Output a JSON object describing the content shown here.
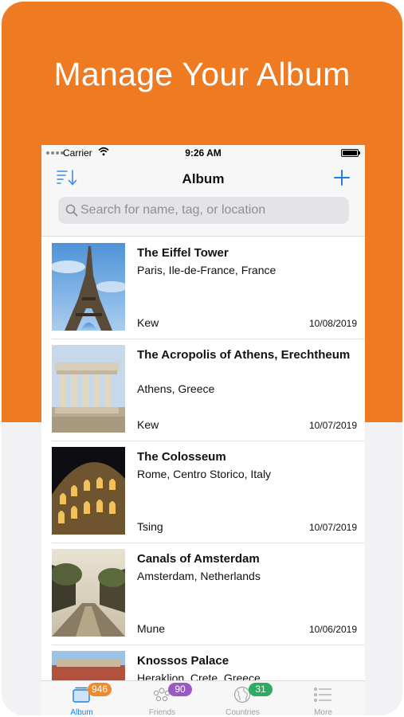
{
  "headline": "Manage Your Album",
  "status": {
    "carrier": "Carrier",
    "time": "9:26 AM"
  },
  "nav": {
    "title": "Album",
    "sort_icon": "sort-icon",
    "add_icon": "plus-icon"
  },
  "search": {
    "placeholder": "Search for name, tag, or location",
    "value": ""
  },
  "items": [
    {
      "name": "The Eiffel Tower",
      "location": "Paris, Ile-de-France, France",
      "user": "Kew",
      "date": "10/08/2019"
    },
    {
      "name": "The Acropolis of  Athens, Erechtheum",
      "location": "Athens, Greece",
      "user": "Kew",
      "date": "10/07/2019"
    },
    {
      "name": "The Colosseum",
      "location": "Rome, Centro Storico, Italy",
      "user": "Tsing",
      "date": "10/07/2019"
    },
    {
      "name": "Canals of Amsterdam",
      "location": "Amsterdam, Netherlands",
      "user": "Mune",
      "date": "10/06/2019"
    },
    {
      "name": "Knossos Palace",
      "location": "Heraklion, Crete, Greece",
      "user": "",
      "date": ""
    }
  ],
  "tabs": [
    {
      "label": "Album",
      "badge": "946",
      "badge_color": "#f08a2c",
      "active": true
    },
    {
      "label": "Friends",
      "badge": "90",
      "badge_color": "#9b59c6",
      "active": false
    },
    {
      "label": "Countries",
      "badge": "31",
      "badge_color": "#2eaa62",
      "active": false
    },
    {
      "label": "More",
      "badge": "",
      "active": false
    }
  ],
  "colors": {
    "accent": "#ee7a22",
    "tint": "#1f7fde"
  }
}
